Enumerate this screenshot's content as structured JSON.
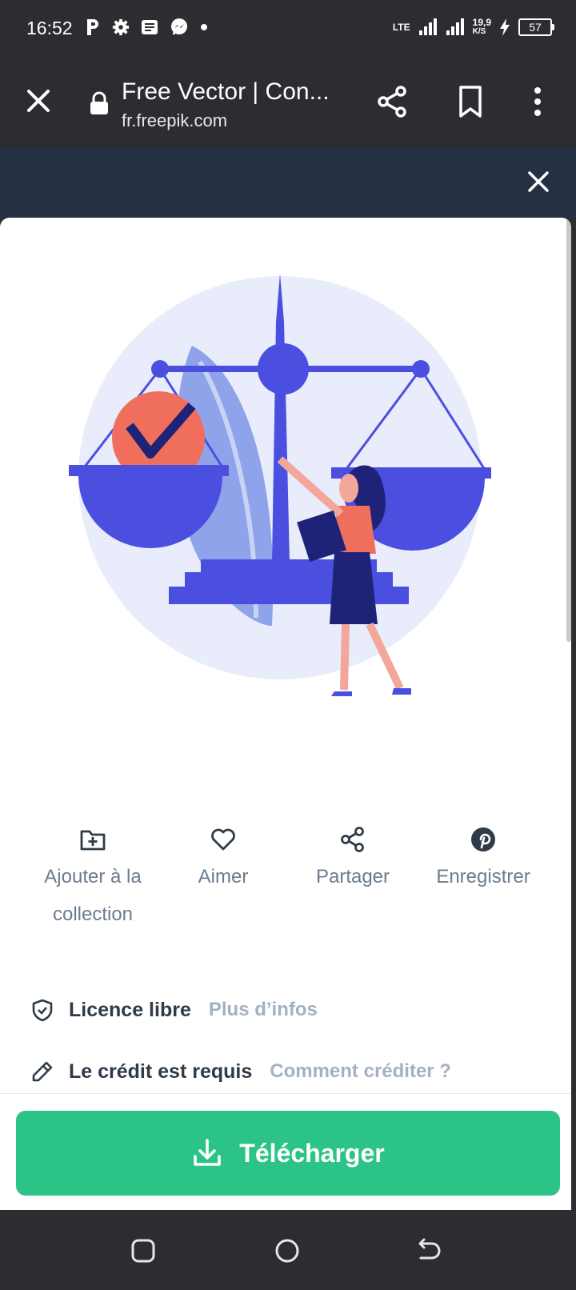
{
  "status_bar": {
    "time": "16:52",
    "network": "LTE",
    "speed_top": "19,9",
    "speed_unit": "K/S",
    "battery": "57"
  },
  "browser": {
    "page_title": "Free Vector | Con...",
    "url": "fr.freepik.com"
  },
  "actions": [
    {
      "label_line1": "Ajouter à la",
      "label_line2": "collection",
      "icon": "folder-plus-icon"
    },
    {
      "label_line1": "Aimer",
      "icon": "heart-icon"
    },
    {
      "label_line1": "Partager",
      "icon": "share-icon"
    },
    {
      "label_line1": "Enregistrer",
      "icon": "pinterest-icon"
    }
  ],
  "license": {
    "type_label": "Licence libre",
    "type_link": "Plus d’infos",
    "credit_label": "Le crédit est requis",
    "credit_link": "Comment créditer ?"
  },
  "download": {
    "label": "Télécharger",
    "color": "#2cc486"
  },
  "colors": {
    "bar": "#2b2d31",
    "accent_blue": "#4a4fe0",
    "accent_coral": "#f06e5c"
  }
}
